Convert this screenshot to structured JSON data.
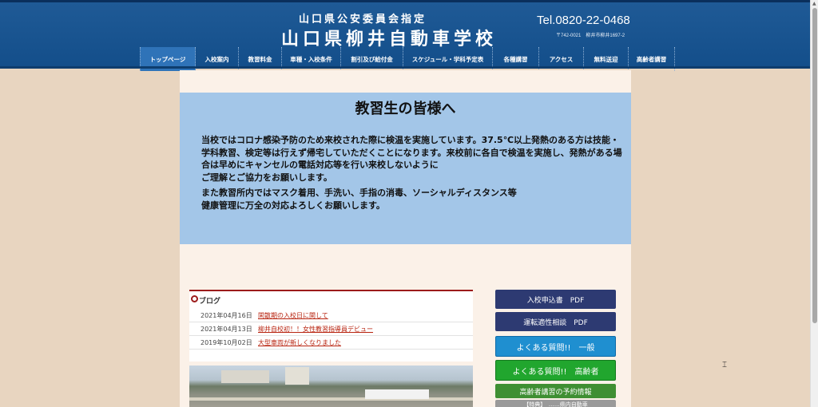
{
  "header": {
    "subtitle": "山口県公安委員会指定",
    "school_name": "山口県柳井自動車学校",
    "tel": "Tel.0820-22-0468",
    "address": "〒742-0021　柳井市柳井1697-2"
  },
  "nav": [
    {
      "label": "トップページ"
    },
    {
      "label": "入校案内"
    },
    {
      "label": "教習料金"
    },
    {
      "label": "車種・入校条件"
    },
    {
      "label": "割引及び給付金"
    },
    {
      "label": "スケジュール・学科予定表"
    },
    {
      "label": "各種講習"
    },
    {
      "label": "アクセス"
    },
    {
      "label": "無料送迎"
    },
    {
      "label": "高齢者講習"
    }
  ],
  "notice": {
    "title": "教習生の皆様へ",
    "p1": "当校ではコロナ感染予防のため来校された際に検温を実施しています。37.5℃以上発熱のある方は技能・学科教習、検定等は行えず帰宅していただくことになります。来校前に各自で検温を実施し、発熱がある場合は早めにキャンセルの電話対応等を行い来校しないように\nご理解とご協力をお願いします。",
    "p2": "また教習所内ではマスク着用、手洗い、手指の消毒、ソーシャルディスタンス等\n健康管理に万全の対応よろしくお願いします。"
  },
  "blog": {
    "heading": "ブログ",
    "entries": [
      {
        "date": "2021年04月16日",
        "title": "閑散期の入校日に関して"
      },
      {
        "date": "2021年04月13日",
        "title": "柳井自校初！！女性教習指導員デビュー"
      },
      {
        "date": "2019年10月02日",
        "title": "大型車両が新しくなりました"
      }
    ]
  },
  "side_buttons": {
    "apply": "入校申込書　PDF",
    "aptitude": "運転適性相談　PDF",
    "faq_general": "よくある質問!!　一般",
    "faq_elderly": "よくある質問!!　高齢者",
    "reservation": "高齢者講習の予約情報",
    "extra": "【特典】　……県内自動車"
  },
  "colors": {
    "header_blue": "#1a5590",
    "notice_blue": "#a3c6e8",
    "accent_red": "#9c1b1b",
    "faq_general": "#1f8fd0",
    "faq_elderly": "#21a62e"
  }
}
